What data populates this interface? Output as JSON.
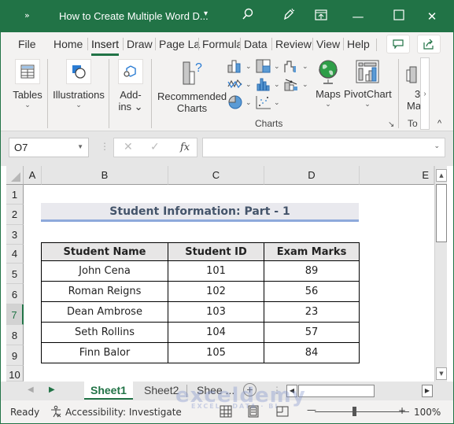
{
  "titlebar": {
    "qat_label": "»",
    "title": "How to Create Multiple Word D...",
    "title_dropdown": "▾",
    "search_icon": "⚲",
    "pen_icon": "✐",
    "ribbon_display_icon": "⊡",
    "minimize": "—",
    "maximize": "☐",
    "close": "✕"
  },
  "tabs": [
    {
      "label": "File"
    },
    {
      "label": "Home"
    },
    {
      "label": "Insert",
      "active": true
    },
    {
      "label": "Draw"
    },
    {
      "label": "Page La"
    },
    {
      "label": "Formula"
    },
    {
      "label": "Data"
    },
    {
      "label": "Review"
    },
    {
      "label": "View"
    },
    {
      "label": "Help"
    }
  ],
  "ribbon": {
    "tables": {
      "label": "Tables",
      "chevron": "⌄"
    },
    "illustrations": {
      "label": "Illustrations",
      "chevron": "⌄"
    },
    "addins": {
      "label1": "Add-",
      "label2": "ins ⌄"
    },
    "recommended_charts": {
      "label1": "Recommended",
      "label2": "Charts"
    },
    "maps": {
      "label": "Maps",
      "chevron": "⌄"
    },
    "pivotchart": {
      "label": "PivotChart",
      "chevron": "⌄"
    },
    "threed": {
      "label1": "3",
      "label2": "Ma"
    },
    "charts_group_label": "Charts",
    "tours_group_label": "To",
    "scroll_right": "›",
    "collapse": "^"
  },
  "formula_bar": {
    "name_box": "O7",
    "cancel": "✕",
    "enter": "✓",
    "fx": "fx",
    "formula_value": ""
  },
  "columns": [
    "A",
    "B",
    "C",
    "D",
    "E"
  ],
  "rows": [
    "1",
    "2",
    "3",
    "4",
    "5",
    "6",
    "7",
    "8",
    "9",
    "10"
  ],
  "selected_row": "7",
  "sheet": {
    "title": "Student Information: Part - 1",
    "headers": [
      "Student Name",
      "Student ID",
      "Exam Marks"
    ],
    "records": [
      [
        "John Cena",
        "101",
        "89"
      ],
      [
        "Roman Reigns",
        "102",
        "56"
      ],
      [
        "Dean Ambrose",
        "103",
        "23"
      ],
      [
        "Seth Rollins",
        "104",
        "57"
      ],
      [
        "Finn Balor",
        "105",
        "84"
      ]
    ]
  },
  "sheet_tabs": [
    {
      "label": "Sheet1",
      "active": true
    },
    {
      "label": "Sheet2"
    },
    {
      "label": "Shee ..."
    }
  ],
  "add_sheet": "+",
  "status": {
    "ready": "Ready",
    "accessibility": "Accessibility: Investigate",
    "zoom_minus": "—",
    "zoom_plus": "+",
    "zoom_level": "100%"
  },
  "watermark": {
    "main": "exceldemy",
    "sub": "EXCEL · DATA · BI"
  }
}
